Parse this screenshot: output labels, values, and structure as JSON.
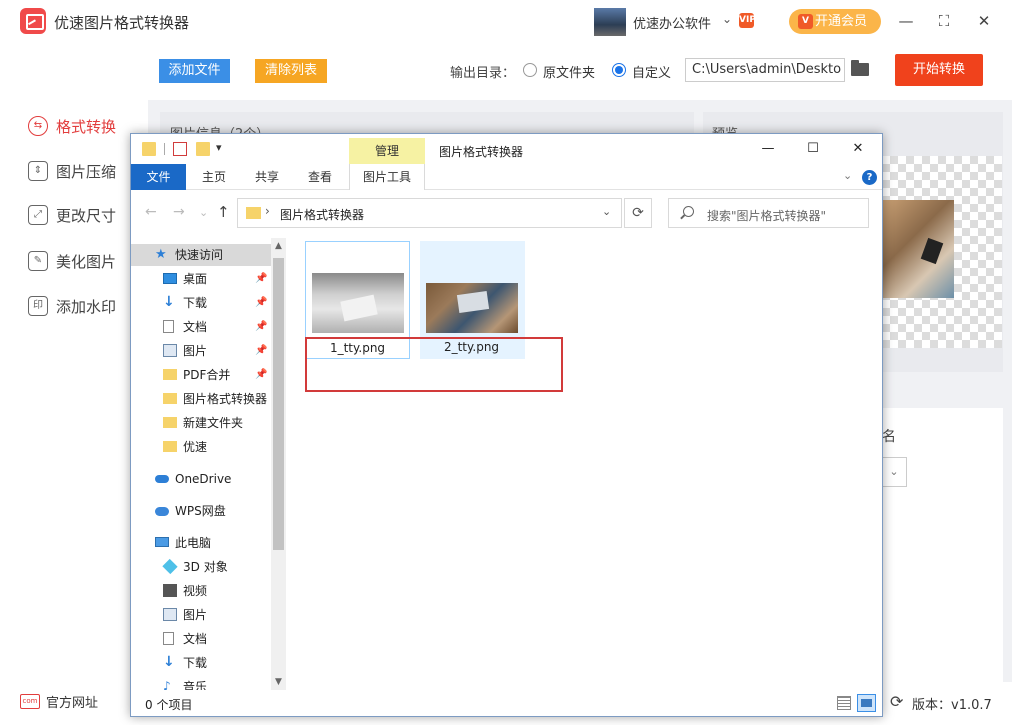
{
  "app": {
    "title": "优速图片格式转换器",
    "user_name": "优速办公软件",
    "user_chevron": "⌄",
    "vip_badge": "VIP",
    "member_button": "开通会员",
    "member_icon": "V",
    "window_controls": {
      "minimize": "—",
      "maximize": "⛶",
      "close": "✕"
    }
  },
  "left_nav": {
    "items": [
      {
        "label": "格式转换",
        "icon": "format-convert-icon",
        "glyph": "⇆",
        "active": true
      },
      {
        "label": "图片压缩",
        "icon": "compress-icon",
        "glyph": "⇕",
        "active": false
      },
      {
        "label": "更改尺寸",
        "icon": "resize-icon",
        "glyph": "⤢",
        "active": false
      },
      {
        "label": "美化图片",
        "icon": "beautify-icon",
        "glyph": "✎",
        "active": false
      },
      {
        "label": "添加水印",
        "icon": "watermark-icon",
        "glyph": "印",
        "active": false
      }
    ],
    "official_site": "官方网址",
    "official_site_icon": "com"
  },
  "toolbar": {
    "add_file": "添加文件",
    "clear_list": "清除列表",
    "output_label": "输出目录：",
    "radio_original": "原文件夹",
    "radio_custom": "自定义",
    "output_path": "C:\\Users\\admin\\Deskto",
    "start_button": "开始转换"
  },
  "panels": {
    "left_header": "图片信息（2个）",
    "right_header": "预览",
    "settings_text": "名",
    "settings_select_chevron": "⌄",
    "version": "版本：v1.0.7",
    "refresh_glyph": "⟳"
  },
  "explorer": {
    "manage_tab": "管理",
    "title": "图片格式转换器",
    "window_controls": {
      "minimize": "—",
      "maximize": "☐",
      "close": "✕"
    },
    "qa_dropdown": "▾",
    "tabs": {
      "file": "文件",
      "home": "主页",
      "share": "共享",
      "view": "查看",
      "picture_tools": "图片工具"
    },
    "ribbon_collapse": "⌄",
    "help": "?",
    "nav": {
      "back": "←",
      "forward": "→",
      "recent": "⌄",
      "up": "↑"
    },
    "address": {
      "separator": "›",
      "path": "图片格式转换器",
      "dropdown": "⌄"
    },
    "refresh": "⟳",
    "search_placeholder": "搜索\"图片格式转换器\"",
    "nav_pane": [
      {
        "label": "快速访问",
        "icon": "star",
        "glyph": "★",
        "indent": 1,
        "pinned": false,
        "selected": true
      },
      {
        "label": "桌面",
        "icon": "desk",
        "indent": 2,
        "pinned": true
      },
      {
        "label": "下载",
        "icon": "down",
        "glyph": "↓",
        "indent": 2,
        "pinned": true
      },
      {
        "label": "文档",
        "icon": "doc",
        "indent": 2,
        "pinned": true
      },
      {
        "label": "图片",
        "icon": "pic",
        "indent": 2,
        "pinned": true
      },
      {
        "label": "PDF合并",
        "icon": "fold",
        "indent": 2,
        "pinned": true
      },
      {
        "label": "图片格式转换器",
        "icon": "fold",
        "indent": 2,
        "pinned": false
      },
      {
        "label": "新建文件夹",
        "icon": "fold",
        "indent": 2,
        "pinned": false
      },
      {
        "label": "优速",
        "icon": "fold",
        "indent": 2,
        "pinned": false
      },
      {
        "label": "OneDrive",
        "icon": "cloud",
        "indent": 1,
        "pinned": false
      },
      {
        "label": "WPS网盘",
        "icon": "wps",
        "indent": 1,
        "pinned": false
      },
      {
        "label": "此电脑",
        "icon": "pc",
        "indent": 1,
        "pinned": false
      },
      {
        "label": "3D 对象",
        "icon": "cube",
        "indent": 2,
        "pinned": false
      },
      {
        "label": "视频",
        "icon": "video",
        "indent": 2,
        "pinned": false
      },
      {
        "label": "图片",
        "icon": "pic",
        "indent": 2,
        "pinned": false
      },
      {
        "label": "文档",
        "icon": "doc",
        "indent": 2,
        "pinned": false
      },
      {
        "label": "下载",
        "icon": "down",
        "glyph": "↓",
        "indent": 2,
        "pinned": false
      },
      {
        "label": "音乐",
        "icon": "music",
        "glyph": "♪",
        "indent": 2,
        "pinned": false
      }
    ],
    "pin_glyph": "📌",
    "scroll_up": "▲",
    "scroll_down": "▼",
    "files": [
      {
        "name": "1_tty.png"
      },
      {
        "name": "2_tty.png"
      }
    ],
    "status": "0 个项目"
  }
}
